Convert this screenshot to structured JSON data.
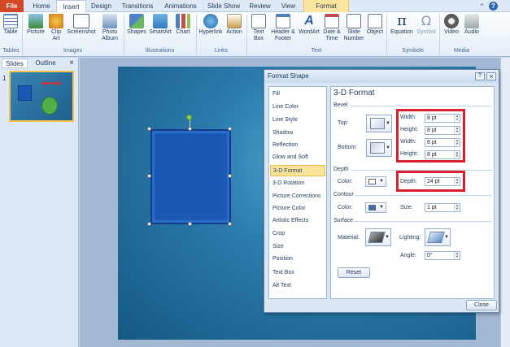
{
  "tabs": [
    "File",
    "Home",
    "Insert",
    "Design",
    "Transitions",
    "Animations",
    "Slide Show",
    "Review",
    "View",
    "Format"
  ],
  "ribbon": {
    "items": [
      {
        "label": "Table",
        "icon": "table-icon",
        "name": "table-button"
      },
      {
        "label": "Picture",
        "icon": "picture-icon",
        "name": "picture-button"
      },
      {
        "label": "Clip Art",
        "icon": "clip-art-icon",
        "name": "clip-art-button"
      },
      {
        "label": "Screenshot",
        "icon": "screenshot-icon",
        "name": "screenshot-button"
      },
      {
        "label": "Photo Album",
        "icon": "photo-album-icon",
        "name": "photo-album-button"
      },
      {
        "label": "Shapes",
        "icon": "shapes-icon",
        "name": "shapes-button"
      },
      {
        "label": "SmartArt",
        "icon": "smartart-icon",
        "name": "smartart-button"
      },
      {
        "label": "Chart",
        "icon": "chart-icon",
        "name": "chart-button"
      },
      {
        "label": "Hyperlink",
        "icon": "hyperlink-icon",
        "name": "hyperlink-button"
      },
      {
        "label": "Action",
        "icon": "action-icon",
        "name": "action-button"
      },
      {
        "label": "Text Box",
        "icon": "text-box-icon",
        "name": "text-box-button"
      },
      {
        "label": "Header & Footer",
        "icon": "header-footer-icon",
        "name": "header-footer-button"
      },
      {
        "label": "WordArt",
        "icon": "wordart-icon",
        "name": "wordart-button"
      },
      {
        "label": "Date & Time",
        "icon": "date-time-icon",
        "name": "date-time-button"
      },
      {
        "label": "Slide Number",
        "icon": "slide-number-icon",
        "name": "slide-number-button"
      },
      {
        "label": "Object",
        "icon": "object-icon",
        "name": "object-button"
      },
      {
        "label": "Equation",
        "icon": "equation-icon",
        "name": "equation-button"
      },
      {
        "label": "Symbol",
        "icon": "symbol-icon",
        "name": "symbol-button"
      },
      {
        "label": "Video",
        "icon": "video-icon",
        "name": "video-button"
      },
      {
        "label": "Audio",
        "icon": "audio-icon",
        "name": "audio-button"
      }
    ],
    "groups": [
      "Tables",
      "Images",
      "Illustrations",
      "Links",
      "Text",
      "Symbols",
      "Media"
    ]
  },
  "slides_pane": {
    "tabs": [
      "Slides",
      "Outline"
    ],
    "close": "×",
    "slide_number": "1"
  },
  "dialog": {
    "title": "Format Shape",
    "help": "?",
    "close_x": "×",
    "nav": [
      "Fill",
      "Line Color",
      "Line Style",
      "Shadow",
      "Reflection",
      "Glow and Soft Edges",
      "3-D Format",
      "3-D Rotation",
      "Picture Corrections",
      "Picture Color",
      "Artistic Effects",
      "Crop",
      "Size",
      "Position",
      "Text Box",
      "Alt Text"
    ],
    "selected_nav": "3-D Format",
    "heading": "3-D Format",
    "bevel": {
      "header": "Bevel",
      "top_label": "Top:",
      "bottom_label": "Bottom:",
      "top_width_label": "Width:",
      "top_width": "8 pt",
      "top_height_label": "Height:",
      "top_height": "8 pt",
      "bottom_width_label": "Width:",
      "bottom_width": "8 pt",
      "bottom_height_label": "Height:",
      "bottom_height": "8 pt"
    },
    "depth": {
      "header": "Depth",
      "color_label": "Color:",
      "depth_label": "Depth:",
      "depth_value": "24 pt"
    },
    "contour": {
      "header": "Contour",
      "color_label": "Color:",
      "size_label": "Size:",
      "size_value": "1 pt"
    },
    "surface": {
      "header": "Surface",
      "material_label": "Material:",
      "lighting_label": "Lighting:",
      "angle_label": "Angle:",
      "angle_value": "0°"
    },
    "reset": "Reset",
    "close": "Close"
  },
  "colors": {
    "accent": "#d24726",
    "highlight": "#d9202c",
    "selected": "#fbe49a",
    "shape_fill": "#1958b4"
  }
}
